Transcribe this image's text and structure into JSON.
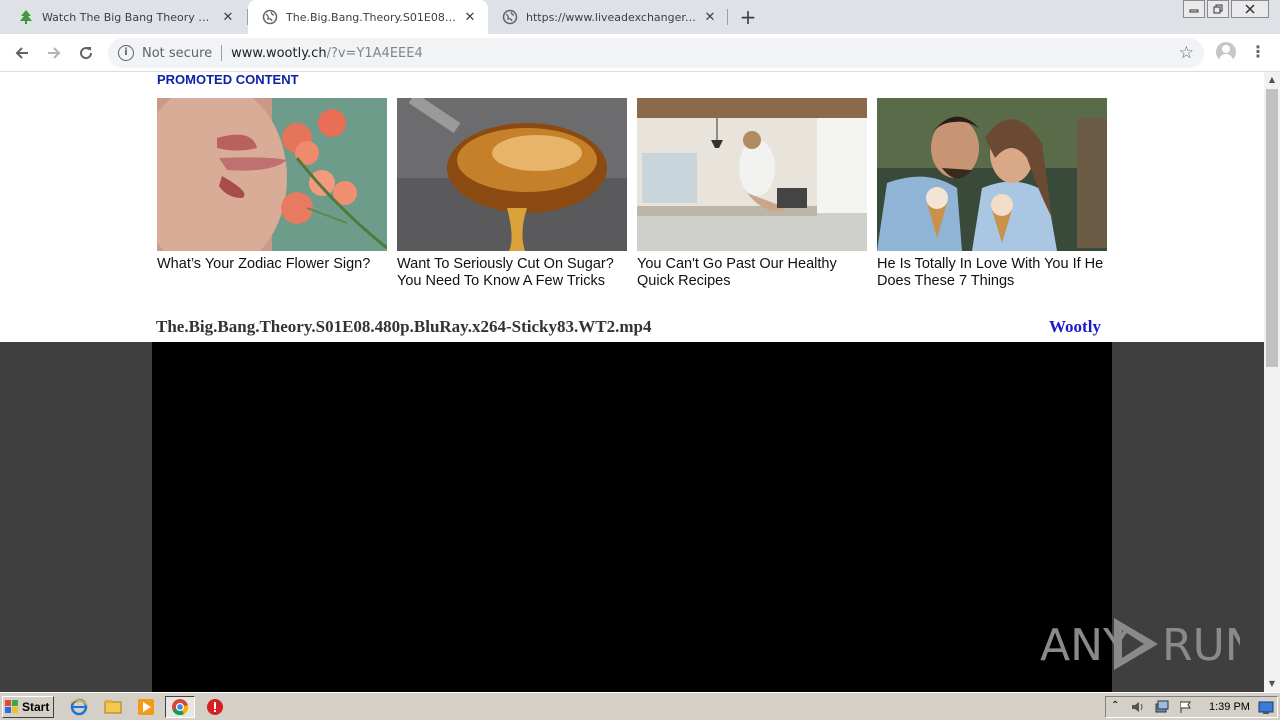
{
  "tabs": [
    {
      "title": "Watch The Big Bang Theory Season",
      "icon": "tree-favicon-icon"
    },
    {
      "title": "The.Big.Bang.Theory.S01E08.480p",
      "icon": "globe-icon",
      "active": true
    },
    {
      "title": "https://www.liveadexchanger.com/",
      "icon": "globe-icon"
    }
  ],
  "toolbar": {
    "security_label": "Not secure",
    "url_host": "www.wootly.ch",
    "url_path": "/?v=Y1A4EEE4"
  },
  "promo": {
    "heading": "PROMOTED CONTENT",
    "cards": [
      {
        "caption": "What’s Your Zodiac Flower Sign?"
      },
      {
        "caption": "Want To Seriously Cut On Sugar? You Need To Know A Few Tricks"
      },
      {
        "caption": "You Can't Go Past Our Healthy Quick Recipes"
      },
      {
        "caption": "He Is Totally In Love With You If He Does These 7 Things"
      }
    ]
  },
  "video": {
    "title": "The.Big.Bang.Theory.S01E08.480p.BluRay.x264-Sticky83.WT2.mp4",
    "brand": "Wootly"
  },
  "watermark": {
    "text_left": "ANY",
    "text_right": "RUN"
  },
  "taskbar": {
    "start_label": "Start",
    "clock": "1:39 PM"
  },
  "colors": {
    "promo_heading": "#0b1fa8",
    "brand": "#1a1acc",
    "player_bg": "#000000",
    "page_dark": "#3f3f3f"
  }
}
